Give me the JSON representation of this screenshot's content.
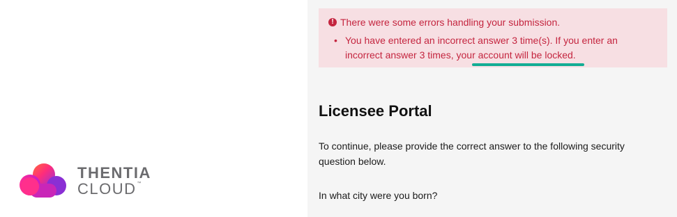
{
  "brand": {
    "name_line1": "THENTIA",
    "name_line2": "CLOUD",
    "trademark": "™",
    "logo_icon": "cloud-logo-icon"
  },
  "alert": {
    "icon": "exclamation-circle-icon",
    "title": "There were some errors handling your submission.",
    "messages": [
      "You have entered an incorrect answer 3 time(s). If you enter an incorrect answer 3 times, your account will be locked."
    ],
    "color": "#c4253f",
    "background": "#f7dfe3",
    "highlight_color": "#13ad94"
  },
  "portal": {
    "title": "Licensee Portal",
    "instructions": "To continue, please provide the correct answer to the following security question below.",
    "security_question": "In what city were you born?"
  }
}
